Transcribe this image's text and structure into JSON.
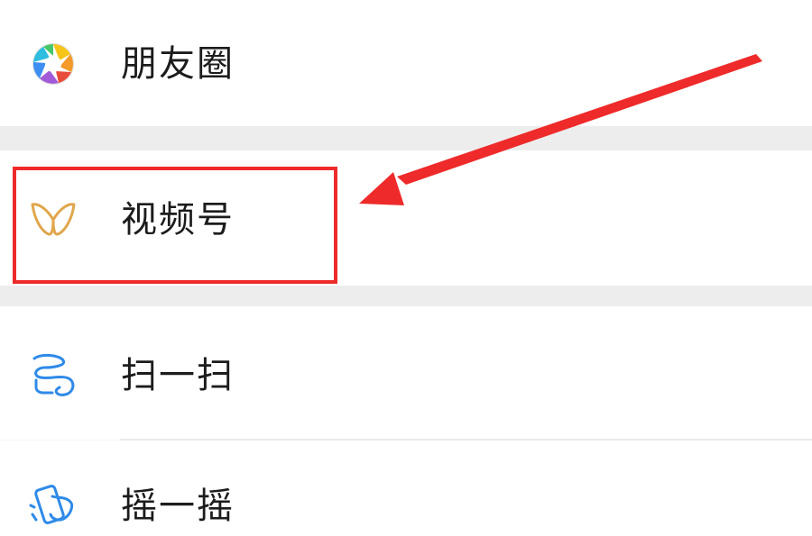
{
  "menu": {
    "items": [
      {
        "label": "朋友圈",
        "icon": "moments-icon"
      },
      {
        "label": "视频号",
        "icon": "channels-icon"
      },
      {
        "label": "扫一扫",
        "icon": "scan-icon"
      },
      {
        "label": "摇一摇",
        "icon": "shake-icon"
      }
    ]
  },
  "annotation": {
    "highlight_color": "#ee2a2a",
    "target_item": "视频号"
  }
}
